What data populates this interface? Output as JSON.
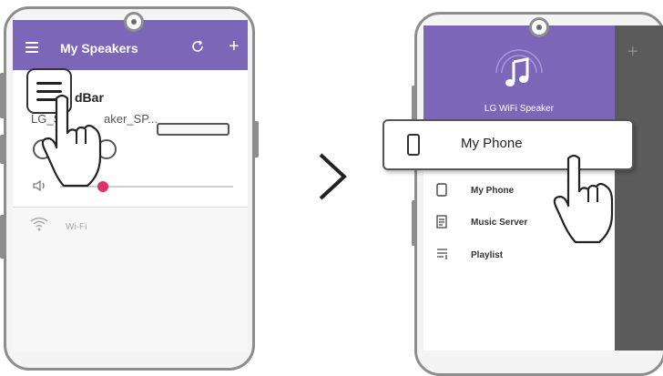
{
  "left_phone": {
    "app_title": "My Speakers",
    "device_name_partial": "dBar",
    "device_sub_partial": "aker_SP...",
    "wifi_label": "Wi-Fi",
    "icons": [
      "menu-icon",
      "refresh-icon",
      "add-icon",
      "volume-icon",
      "wifi-icon",
      "hand-pointer-icon"
    ]
  },
  "arrow": ">",
  "right_phone": {
    "drawer_title": "LG WiFi Speaker",
    "callout_label": "My Phone",
    "menu_items": [
      {
        "label": "My Phone",
        "icon": "phone-icon"
      },
      {
        "label": "Music Server",
        "icon": "music-server-icon"
      },
      {
        "label": "Playlist",
        "icon": "playlist-icon"
      }
    ]
  }
}
